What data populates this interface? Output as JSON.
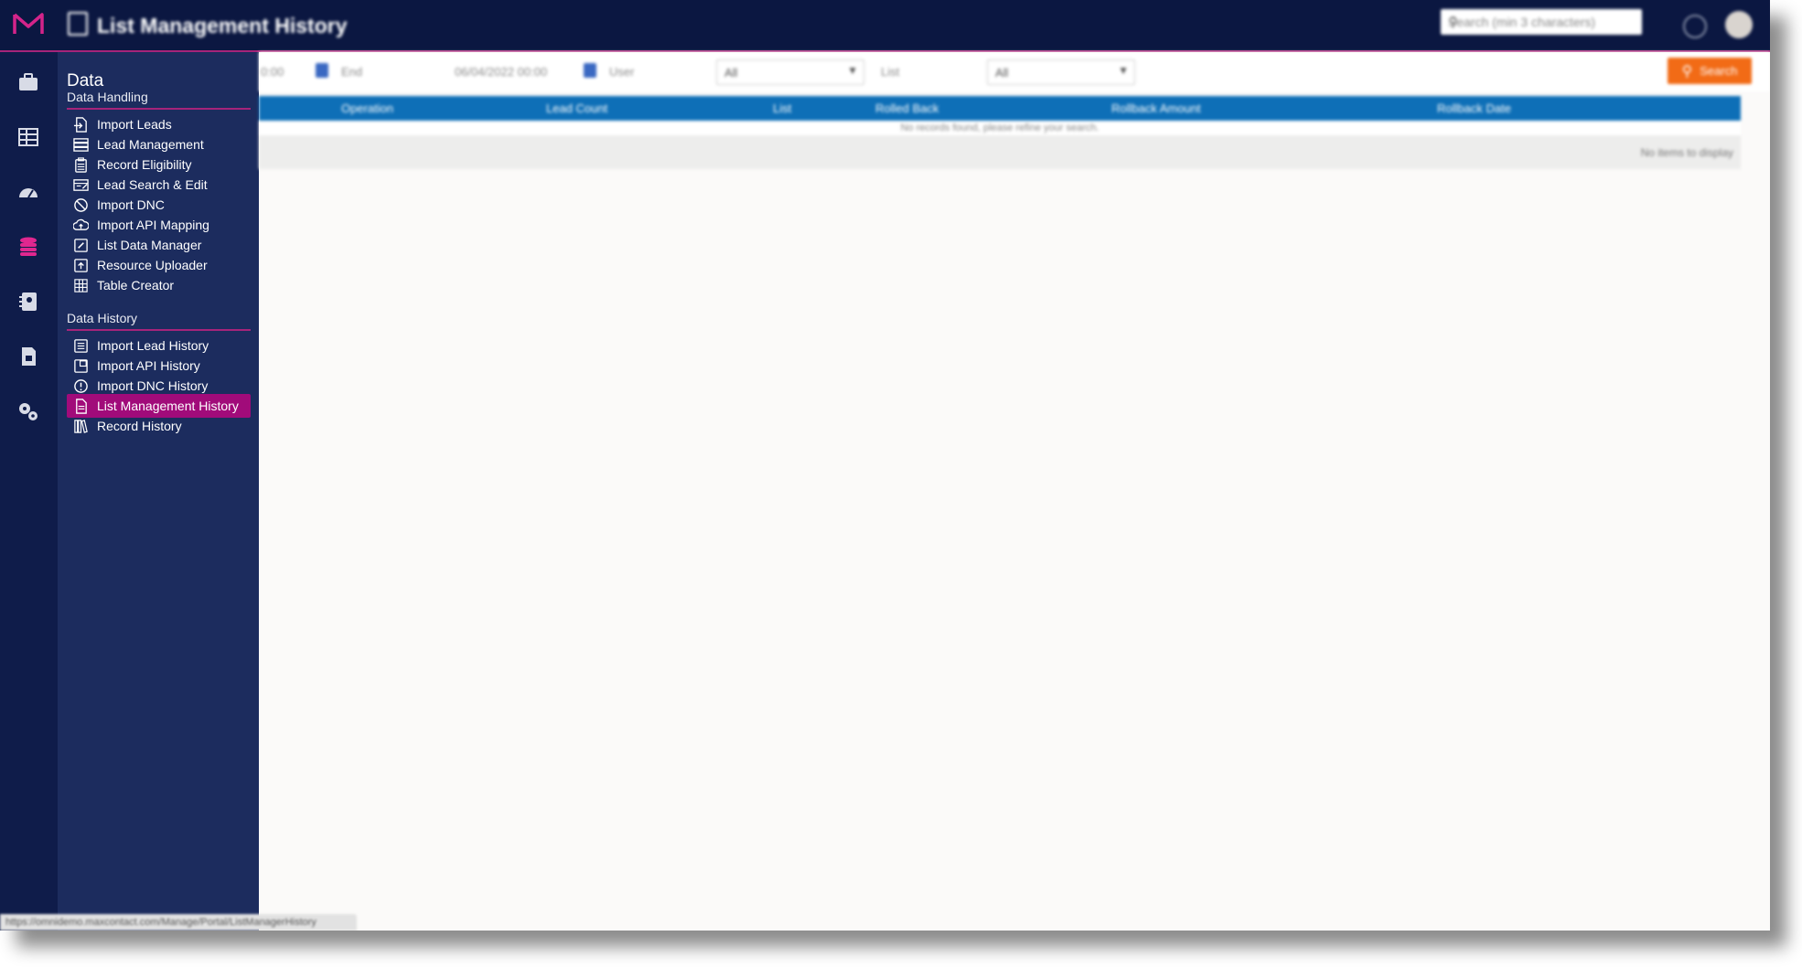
{
  "app": {
    "title": "List Management History",
    "global_search_placeholder": "Search (min 3 characters)",
    "colors": {
      "topbar": "#0b1741",
      "accent": "#a6247a",
      "active_item": "#a10b7a",
      "grid_header": "#0e6fb7",
      "search_button": "#f26b16"
    }
  },
  "rail": {
    "icons": [
      "briefcase-icon",
      "grid-icon",
      "dashboard-gauge-icon",
      "database-icon",
      "contacts-book-icon",
      "document-icon",
      "settings-gears-icon"
    ],
    "active": "database-icon"
  },
  "nav": {
    "title": "Data",
    "groups": [
      {
        "title": "Data Handling",
        "items": [
          {
            "label": "Import Leads",
            "icon": "file-import-icon"
          },
          {
            "label": "Lead Management",
            "icon": "stack-list-icon"
          },
          {
            "label": "Record Eligibility",
            "icon": "clipboard-icon"
          },
          {
            "label": "Lead Search & Edit",
            "icon": "search-table-icon"
          },
          {
            "label": "Import DNC",
            "icon": "ban-icon"
          },
          {
            "label": "Import API Mapping",
            "icon": "cloud-upload-icon"
          },
          {
            "label": "List Data Manager",
            "icon": "edit-square-icon"
          },
          {
            "label": "Resource Uploader",
            "icon": "upload-box-icon"
          },
          {
            "label": "Table Creator",
            "icon": "table-icon"
          }
        ]
      },
      {
        "title": "Data History",
        "items": [
          {
            "label": "Import Lead History",
            "icon": "list-history-icon"
          },
          {
            "label": "Import API History",
            "icon": "api-history-icon"
          },
          {
            "label": "Import DNC History",
            "icon": "alert-circle-icon"
          },
          {
            "label": "List Management History",
            "icon": "document-list-icon",
            "active": true
          },
          {
            "label": "Record History",
            "icon": "books-icon"
          }
        ]
      }
    ]
  },
  "filters": {
    "start_time_fragment": "0:00",
    "end_label": "End",
    "end_value": "06/04/2022 00:00",
    "user_label": "User",
    "user_value": "All",
    "list_label": "List",
    "list_value": "All",
    "search_label": "Search"
  },
  "grid": {
    "columns": [
      "Operation",
      "Lead Count",
      "List",
      "Rolled Back",
      "Rollback Amount",
      "Rollback Date"
    ],
    "empty_message": "No records found, please refine your search.",
    "pager_text": "No items to display"
  },
  "status_bar": {
    "url": "https://omnidemo.maxcontact.com/Manage/Portal/ListManagerHistory"
  }
}
